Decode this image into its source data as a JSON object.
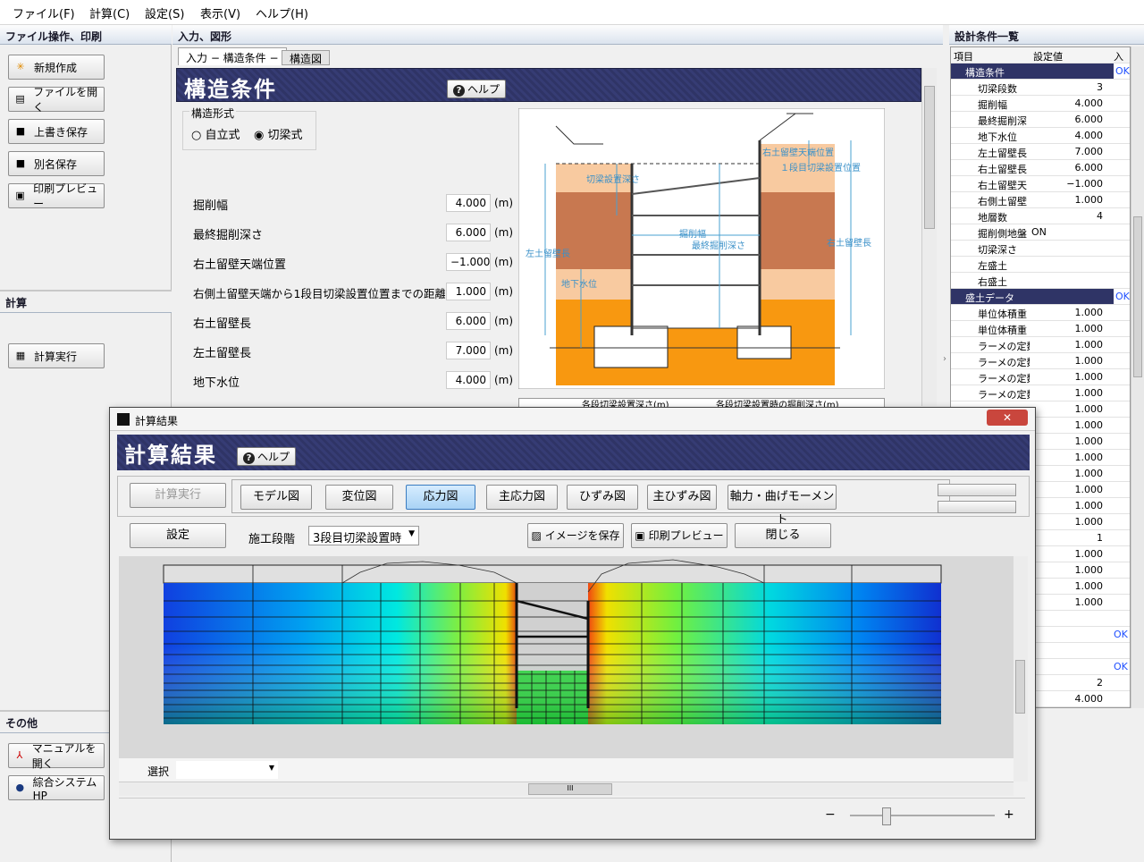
{
  "menu": [
    "ファイル(F)",
    "計算(C)",
    "設定(S)",
    "表示(V)",
    "ヘルプ(H)"
  ],
  "left": {
    "file_section": "ファイル操作、印刷",
    "file_buttons": [
      "新規作成",
      "ファイルを開く",
      "上書き保存",
      "別名保存",
      "印刷プレビュー"
    ],
    "calc_section": "計算",
    "calc_button": "計算実行",
    "other_section": "その他",
    "other_buttons": [
      "マニュアルを開く",
      "綜合システムHP"
    ]
  },
  "center": {
    "section": "入力、図形",
    "tabs": [
      "入力 − 構造条件 −",
      "構造図"
    ],
    "form_title": "構造条件",
    "help": "ヘルプ",
    "structure_type_label": "構造形式",
    "radio_options": [
      "自立式",
      "切梁式"
    ],
    "selected_radio": "切梁式",
    "fields": [
      {
        "label": "掘削幅",
        "value": "4.000",
        "unit": "(m)"
      },
      {
        "label": "最終掘削深さ",
        "value": "6.000",
        "unit": "(m)"
      },
      {
        "label": "右土留壁天端位置",
        "value": "−1.000",
        "unit": "(m)"
      },
      {
        "label": "右側土留壁天端から1段目切梁設置位置までの距離",
        "value": "1.000",
        "unit": "(m)"
      },
      {
        "label": "右土留壁長",
        "value": "6.000",
        "unit": "(m)"
      },
      {
        "label": "左土留壁長",
        "value": "7.000",
        "unit": "(m)"
      },
      {
        "label": "地下水位",
        "value": "4.000",
        "unit": "(m)"
      }
    ],
    "diagram_labels": {
      "right_top": "右土留壁天端位置",
      "first_strut": "１段目切梁設置位置",
      "strut_depth": "切梁設置深さ",
      "excavation_width": "掘削幅",
      "final_depth": "最終掘削深さ",
      "left_wall": "左土留壁長",
      "right_wall": "右土留壁長",
      "groundwater": "地下水位"
    },
    "table_headers": [
      "各段切梁設置深さ(m)",
      "各段切梁設置時の掘削深さ(m)"
    ]
  },
  "right": {
    "title": "設計条件一覧",
    "col_headers": [
      "項目",
      "設定値",
      "入力"
    ],
    "rows": [
      {
        "group": true,
        "k": "構造条件",
        "v": "",
        "ok": "OK"
      },
      {
        "k": "切梁段数",
        "v": "3"
      },
      {
        "k": "掘削幅",
        "v": "4.000"
      },
      {
        "k": "最終掘削深",
        "v": "6.000"
      },
      {
        "k": "地下水位",
        "v": "4.000"
      },
      {
        "k": "左土留壁長",
        "v": "7.000"
      },
      {
        "k": "右土留壁長",
        "v": "6.000"
      },
      {
        "k": "右土留壁天",
        "v": "−1.000"
      },
      {
        "k": "右側土留壁",
        "v": "1.000"
      },
      {
        "k": "地層数",
        "v": "4"
      },
      {
        "k": "掘削側地盤",
        "v": "ON",
        "left": true
      },
      {
        "k": "切梁深さ",
        "v": ""
      },
      {
        "k": "左盛土",
        "v": ""
      },
      {
        "k": "右盛土",
        "v": ""
      },
      {
        "group": true,
        "k": "盛土データ",
        "v": "",
        "ok": "OK"
      },
      {
        "k": "単位体積重",
        "v": "1.000"
      },
      {
        "k": "単位体積重",
        "v": "1.000"
      },
      {
        "k": "ラーメの定数",
        "v": "1.000"
      },
      {
        "k": "ラーメの定数",
        "v": "1.000"
      },
      {
        "k": "ラーメの定数",
        "v": "1.000"
      },
      {
        "k": "ラーメの定数",
        "v": "1.000"
      }
    ],
    "extra_values": [
      "1.000",
      "1.000",
      "1.000",
      "1.000",
      "1.000",
      "1.000",
      "1.000",
      "1.000",
      "1",
      "1.000",
      "1.000",
      "1.000",
      "1.000",
      "",
      "OK",
      "",
      "OK",
      "2",
      "4.000",
      "4.000"
    ]
  },
  "dialog": {
    "window_title": "計算結果",
    "header": "計算結果",
    "help": "ヘルプ",
    "calc_button": "計算実行",
    "view_buttons": [
      "モデル図",
      "変位図",
      "応力図",
      "主応力図",
      "ひずみ図",
      "主ひずみ図",
      "軸力・曲げモーメント"
    ],
    "selected_view": "応力図",
    "settings": "設定",
    "stage_label": "施工段階",
    "stage_value": "3段目切梁設置時",
    "save_image": "イメージを保存",
    "print_preview": "印刷プレビュー",
    "close": "閉じる",
    "select_label": "選択",
    "zoom_minus": "−",
    "zoom_plus": "+",
    "hscroll_grip": "III"
  },
  "colors": {
    "header_dark": "#2f3466",
    "ok_blue": "#2050ff"
  }
}
